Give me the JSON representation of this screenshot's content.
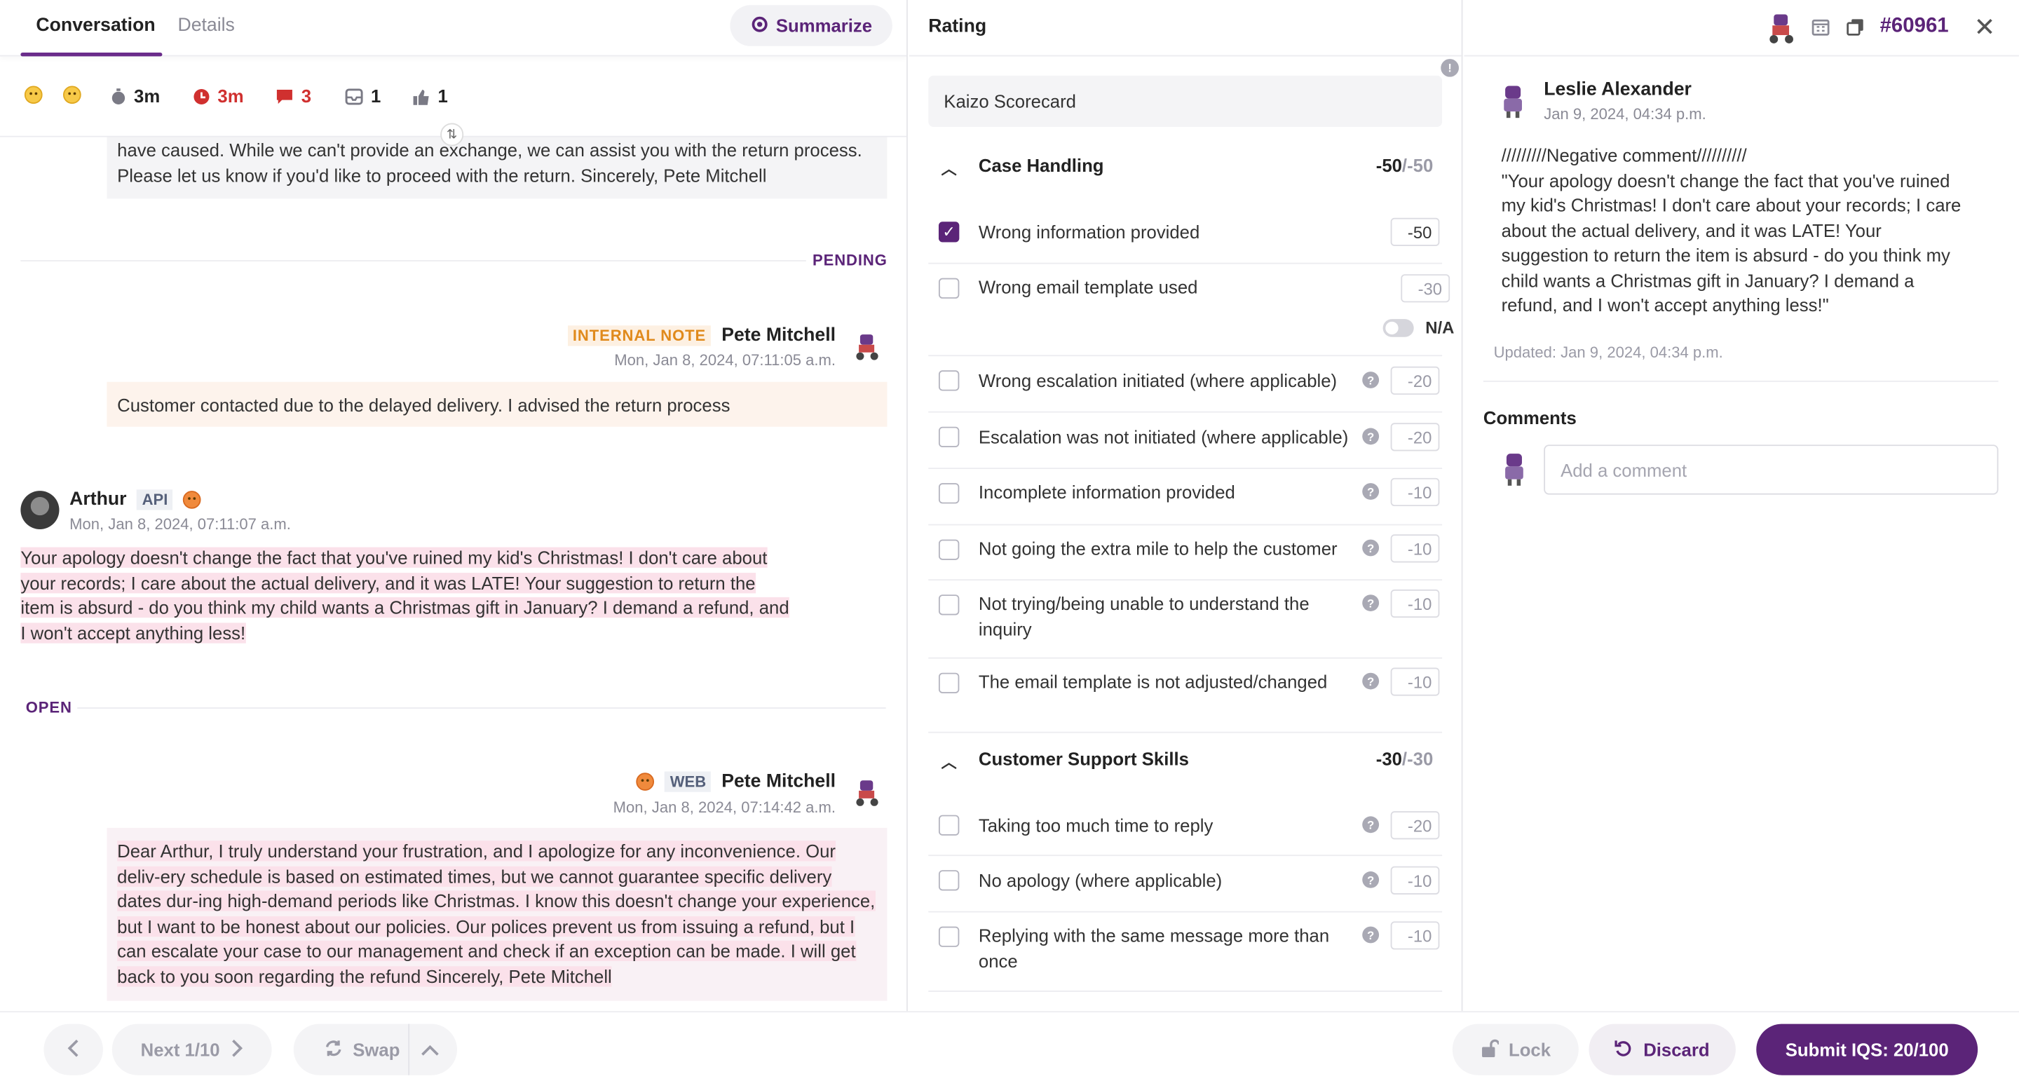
{
  "tabs": {
    "conversation": "Conversation",
    "details": "Details"
  },
  "summarize_label": "Summarize",
  "stats": {
    "first_reply": "3m",
    "resolution": "3m",
    "messages": "3",
    "tickets": "1",
    "likes": "1"
  },
  "conversation": {
    "agent_tail": "have caused. While we can't provide an exchange, we can assist you with the return process. Please let us know if you'd like to proceed with the return. Sincerely, Pete Mitchell",
    "pending_label": "PENDING",
    "note": {
      "badge": "INTERNAL NOTE",
      "author": "Pete Mitchell",
      "time": "Mon, Jan 8, 2024, 07:11:05 a.m.",
      "text": "Customer contacted due to the delayed delivery. I advised the return process"
    },
    "customer": {
      "author": "Arthur",
      "channel": "API",
      "time": "Mon, Jan 8, 2024, 07:11:07 a.m.",
      "text": "Your apology doesn't change the fact that you've ruined my kid's Christmas! I don't care about your records; I care about the actual delivery, and it was LATE! Your suggestion to return the item is absurd - do you think my child wants a Christmas gift in January? I demand a refund, and I won't accept anything less!"
    },
    "open_label": "OPEN",
    "reply": {
      "channel": "WEB",
      "author": "Pete Mitchell",
      "time": "Mon, Jan 8, 2024, 07:14:42 a.m.",
      "text": "Dear Arthur, I truly understand your frustration, and I apologize for any inconvenience. Our deliv-ery schedule is based on estimated times, but we cannot guarantee specific delivery dates dur-ing high-demand periods like Christmas. I know this doesn't change your experience, but I want to be honest about our policies. Our polices prevent us from issuing a refund, but I can escalate your case to our management and check if an exception can be made. I will get back to you soon regarding the refund Sincerely, Pete Mitchell"
    }
  },
  "rating": {
    "title": "Rating",
    "scorecard": "Kaizo Scorecard",
    "sections": [
      {
        "title": "Case Handling",
        "score": "-50",
        "max": "/-50",
        "criteria": [
          {
            "label": "Wrong information provided",
            "points": "-50",
            "checked": true
          },
          {
            "label": "Wrong email template used",
            "points": "-30",
            "checked": false,
            "na": "N/A"
          },
          {
            "label": "Wrong escalation initiated (where applicable)",
            "points": "-20",
            "checked": false
          },
          {
            "label": "Escalation was not initiated (where applicable)",
            "points": "-20",
            "checked": false
          },
          {
            "label": "Incomplete information provided",
            "points": "-10",
            "checked": false
          },
          {
            "label": "Not going the extra mile to help the customer",
            "points": "-10",
            "checked": false
          },
          {
            "label": "Not trying/being unable to understand the inquiry",
            "points": "-10",
            "checked": false
          },
          {
            "label": "The email template is not adjusted/changed",
            "points": "-10",
            "checked": false
          }
        ]
      },
      {
        "title": "Customer Support Skills",
        "score": "-30",
        "max": "/-30",
        "criteria": [
          {
            "label": "Taking too much time to reply",
            "points": "-20",
            "checked": false
          },
          {
            "label": "No apology (where applicable)",
            "points": "-10",
            "checked": false
          },
          {
            "label": "Replying with the same message more than once",
            "points": "-10",
            "checked": false
          }
        ]
      }
    ]
  },
  "ticket_id": "#60961",
  "comment": {
    "author": "Leslie Alexander",
    "time": "Jan 9, 2024, 04:34 p.m.",
    "text": "/////////Negative comment//////////\n\"Your apology doesn't change the fact that you've ruined my kid's Christmas! I don't care about your records; I care about the actual delivery, and it was LATE! Your suggestion to return the item is absurd - do you think my child wants a Christmas gift in January? I demand a refund, and I won't accept anything less!\"",
    "updated": "Updated: Jan 9, 2024, 04:34 p.m."
  },
  "comments": {
    "title": "Comments",
    "placeholder": "Add a comment"
  },
  "footer": {
    "next": "Next 1/10",
    "swap": "Swap",
    "lock": "Lock",
    "discard": "Discard",
    "submit": "Submit IQS: 20/100"
  },
  "colors": {
    "brand": "#5b2478",
    "note": "#e08a1c",
    "hl": "#fbe1ea",
    "alert": "#d0302f"
  },
  "icons": [
    "face-neutral-icon",
    "face-angry-icon",
    "stopwatch-icon",
    "clock-icon",
    "chat-icon",
    "inbox-icon",
    "thumbs-up-icon",
    "calendar-icon",
    "copy-icon",
    "close-icon",
    "chevron-left-icon",
    "chevron-right-icon",
    "swap-icon",
    "chevron-up-icon",
    "lock-icon",
    "undo-icon"
  ]
}
